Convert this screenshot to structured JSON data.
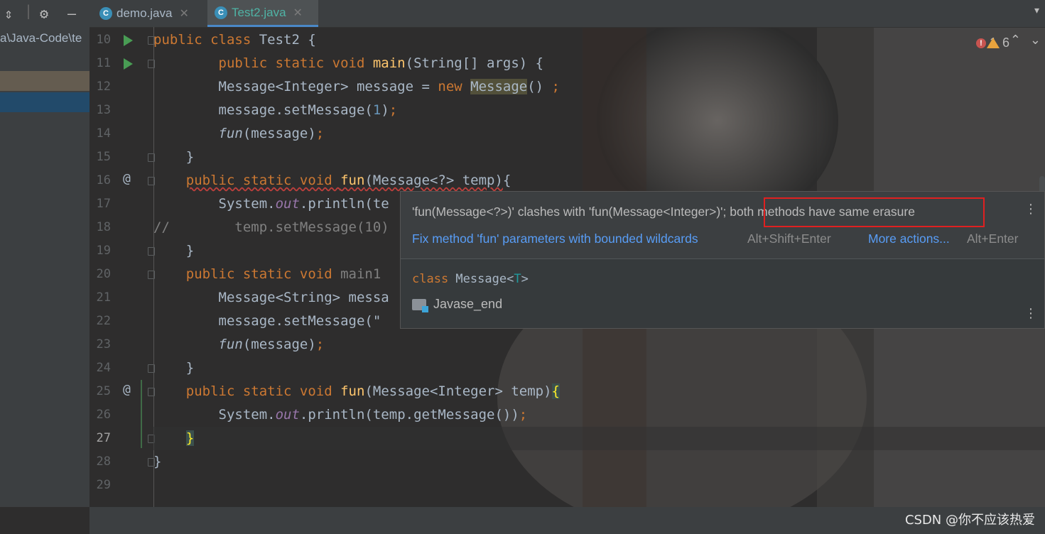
{
  "project": {
    "path_fragment": "a\\Java-Code\\te"
  },
  "tabs": [
    {
      "label": "demo.java",
      "active": false,
      "icon": "java-class-icon"
    },
    {
      "label": "Test2.java",
      "active": true,
      "icon": "java-class-icon"
    }
  ],
  "line_numbers": [
    "10",
    "11",
    "12",
    "13",
    "14",
    "15",
    "16",
    "17",
    "18",
    "19",
    "20",
    "21",
    "22",
    "23",
    "24",
    "25",
    "26",
    "27",
    "28",
    "29"
  ],
  "current_line": "27",
  "code_lines": [
    [
      [
        "kw",
        "public "
      ],
      [
        "kw",
        "class "
      ],
      [
        "tx",
        "Test2 {"
      ]
    ],
    [
      [
        "tx",
        "        "
      ],
      [
        "kw",
        "public static void "
      ],
      [
        "fn",
        "main"
      ],
      [
        "tx",
        "(String[] args) {"
      ]
    ],
    [
      [
        "tx",
        "        Message<Integer> message = "
      ],
      [
        "kw",
        "new "
      ],
      [
        "hl",
        "Message"
      ],
      [
        "tx",
        "() "
      ],
      [
        "kw",
        ";"
      ]
    ],
    [
      [
        "tx",
        "        message.setMessage("
      ],
      [
        "num",
        "1"
      ],
      [
        "tx",
        ")"
      ],
      [
        "kw",
        ";"
      ]
    ],
    [
      [
        "tx",
        "        "
      ],
      [
        "it",
        "fun"
      ],
      [
        "tx",
        "(message)"
      ],
      [
        "kw",
        ";"
      ]
    ],
    [
      [
        "tx",
        "    }"
      ]
    ],
    [
      [
        "tx",
        "    "
      ],
      [
        "kwerr",
        "public static void "
      ],
      [
        "fnerr",
        "fun"
      ],
      [
        "txerr",
        "(Message<?> temp)"
      ],
      [
        "tx",
        "{"
      ]
    ],
    [
      [
        "tx",
        "        System."
      ],
      [
        "fld",
        "out"
      ],
      [
        "tx",
        ".println(te"
      ]
    ],
    [
      [
        "cmt",
        "//        temp.setMessage(10)"
      ]
    ],
    [
      [
        "tx",
        "    }"
      ]
    ],
    [
      [
        "tx",
        "    "
      ],
      [
        "kw",
        "public static void "
      ],
      [
        "cmt",
        "main1"
      ]
    ],
    [
      [
        "tx",
        "        Message<String> messa"
      ]
    ],
    [
      [
        "tx",
        "        message.setMessage(\""
      ]
    ],
    [
      [
        "tx",
        "        "
      ],
      [
        "it",
        "fun"
      ],
      [
        "tx",
        "(message)"
      ],
      [
        "kw",
        ";"
      ]
    ],
    [
      [
        "tx",
        "    }"
      ]
    ],
    [
      [
        "tx",
        "    "
      ],
      [
        "kw",
        "public static void "
      ],
      [
        "fn",
        "fun"
      ],
      [
        "tx",
        "(Message<Integer> temp)"
      ],
      [
        "bh",
        "{"
      ]
    ],
    [
      [
        "tx",
        "        System."
      ],
      [
        "fld",
        "out"
      ],
      [
        "tx",
        ".println(temp.getMessage())"
      ],
      [
        "kw",
        ";"
      ]
    ],
    [
      [
        "tx",
        "    "
      ],
      [
        "bh",
        "}"
      ]
    ],
    [
      [
        "tx",
        "}"
      ]
    ],
    [
      [
        "tx",
        ""
      ]
    ]
  ],
  "inspection": {
    "errors": "1",
    "warnings": "6"
  },
  "popup": {
    "message_part1": "'fun(Message<?>)' clashes with 'fun(Message<Integer>)'; ",
    "message_part2": "both methods have same erasure",
    "fix_label": "Fix method 'fun' parameters with bounded wildcards",
    "fix_shortcut": "Alt+Shift+Enter",
    "more_label": "More actions...",
    "more_shortcut": "Alt+Enter",
    "doc_keyword": "class ",
    "doc_class": "Message<",
    "doc_type_param": "T",
    "doc_close": ">",
    "module": "Javase_end"
  },
  "watermark": "CSDN @你不应该热爱",
  "colors": {
    "keyword": "#cc7832",
    "function": "#ffc66d",
    "link": "#589df6",
    "highlight_box": "#e02020"
  }
}
